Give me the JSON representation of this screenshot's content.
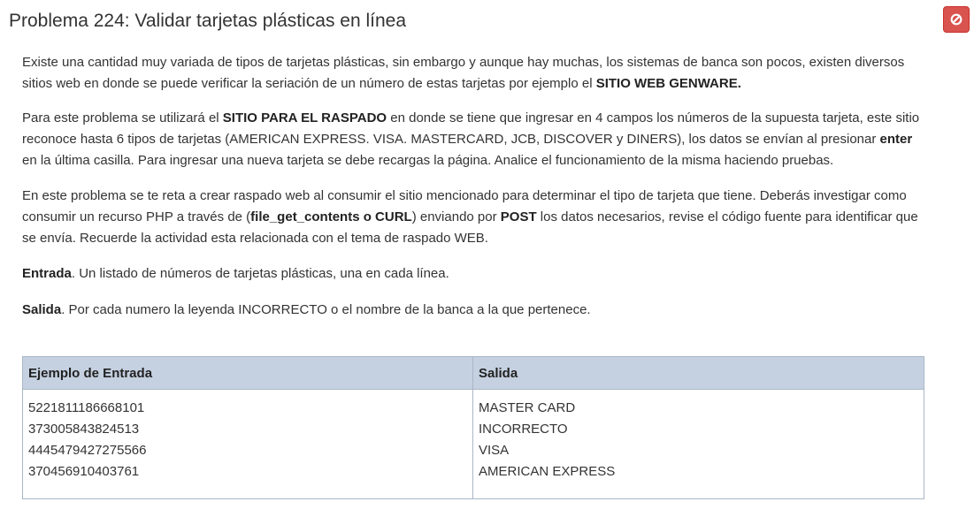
{
  "title": "Problema 224: Validar tarjetas plásticas en línea",
  "stop_icon": "ban-icon",
  "colors": {
    "stop_button": "#d9534f",
    "table_header": "#c5d1e1"
  },
  "p1": {
    "t1": "Existe una cantidad muy variada de tipos de tarjetas plásticas, sin embargo y aunque hay muchas, los sistemas de banca son pocos,  existen diversos sitios web en donde se puede verificar la seriación de un número de estas tarjetas por ejemplo el ",
    "b1": "SITIO WEB GENWARE."
  },
  "p2": {
    "t1": "Para este problema se utilizará el ",
    "b1": "SITIO PARA EL RASPADO",
    "t2": "  en donde se tiene que ingresar en 4 campos los números de la supuesta tarjeta, este sitio reconoce hasta 6  tipos de tarjetas (AMERICAN EXPRESS. VISA. MASTERCARD, JCB, DISCOVER y DINERS),  los datos se envían al presionar ",
    "b2": "enter",
    "t3": " en la última casilla. Para ingresar una nueva tarjeta se debe recargas la página. Analice el funcionamiento de la misma haciendo pruebas."
  },
  "p3": {
    "t1": "En este problema se te reta a crear raspado web al consumir el sitio mencionado para determinar el tipo de tarjeta que tiene. Deberás investigar como consumir un recurso PHP a través de (",
    "b1": "file_get_contents o CURL",
    "t2": ") enviando por ",
    "b2": "POST",
    "t3": " los datos necesarios, revise el código fuente para identificar que se envía. Recuerde la actividad esta relacionada con el tema de raspado WEB."
  },
  "p4": {
    "b1": "Entrada",
    "t1": ". Un listado de números de tarjetas plásticas, una en cada línea."
  },
  "p5": {
    "b1": "Salida",
    "t1": ". Por cada numero la leyenda INCORRECTO o el nombre de la banca a la que pertenece."
  },
  "table": {
    "headers": [
      "Ejemplo de Entrada",
      "Salida"
    ],
    "input_lines": [
      "5221811186668101",
      "373005843824513",
      "4445479427275566",
      "370456910403761"
    ],
    "output_lines": [
      "MASTER CARD",
      "INCORRECTO",
      "VISA",
      "AMERICAN EXPRESS"
    ]
  }
}
